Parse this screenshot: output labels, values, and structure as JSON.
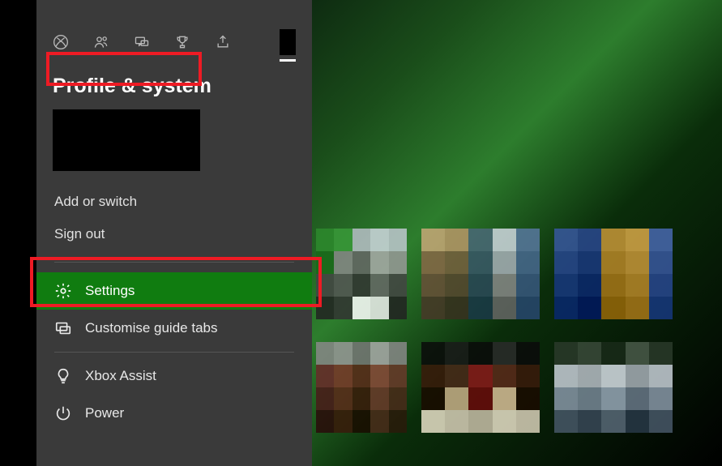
{
  "guide": {
    "heading": "Profile & system",
    "tabs": [
      {
        "name": "xbox-tab",
        "icon": "xbox"
      },
      {
        "name": "people-tab",
        "icon": "people"
      },
      {
        "name": "chat-tab",
        "icon": "chat"
      },
      {
        "name": "achievements-tab",
        "icon": "trophy"
      },
      {
        "name": "share-tab",
        "icon": "share"
      }
    ],
    "account_actions": {
      "add_or_switch": "Add or switch",
      "sign_out": "Sign out"
    },
    "menu": {
      "settings": "Settings",
      "customise_tabs": "Customise guide tabs",
      "xbox_assist": "Xbox Assist",
      "power": "Power"
    },
    "colors": {
      "accent": "#107c10",
      "annotation": "#ee1b24"
    }
  }
}
